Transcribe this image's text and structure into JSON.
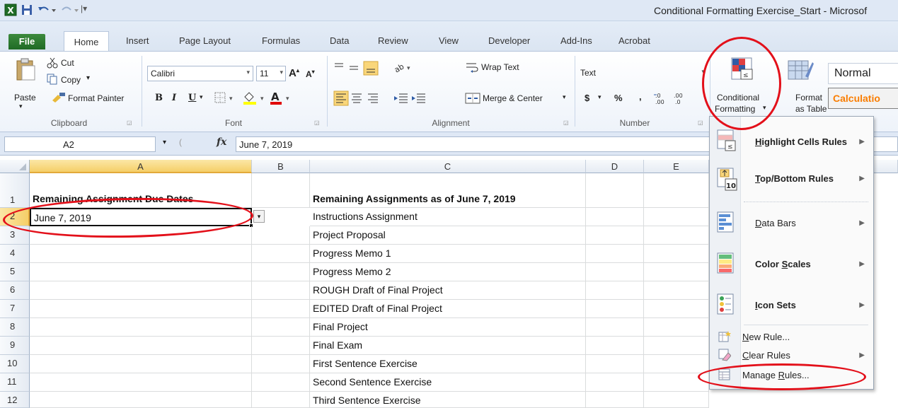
{
  "window": {
    "title": "Conditional Formatting Exercise_Start  -  Microsof"
  },
  "tabs": [
    "File",
    "Home",
    "Insert",
    "Page Layout",
    "Formulas",
    "Data",
    "Review",
    "View",
    "Developer",
    "Add-Ins",
    "Acrobat"
  ],
  "ribbon": {
    "clipboard": {
      "paste": "Paste",
      "cut": "Cut",
      "copy": "Copy",
      "copy_arrow": "▾",
      "format_painter": "Format Painter",
      "label": "Clipboard"
    },
    "font": {
      "name": "Calibri",
      "size": "11",
      "bold": "B",
      "italic": "I",
      "underline": "U",
      "label": "Font"
    },
    "alignment": {
      "wrap_text": "Wrap Text",
      "merge_center": "Merge & Center",
      "label": "Alignment"
    },
    "number": {
      "format": "Text",
      "dollar": "$",
      "percent": "%",
      "comma": ",",
      "label": "Number"
    },
    "styles": {
      "conditional_formatting_line1": "Conditional",
      "conditional_formatting_line2": "Formatting",
      "format_table_line1": "Format",
      "format_table_line2": "as Table",
      "style_normal": "Normal",
      "style_calculation": "Calculatio"
    }
  },
  "formula_bar": {
    "name_box": "A2",
    "fx": "fx",
    "value": "June 7, 2019"
  },
  "columns": [
    "A",
    "B",
    "C",
    "D",
    "E"
  ],
  "rows": [
    "1",
    "2",
    "3",
    "4",
    "5",
    "6",
    "7",
    "8",
    "9",
    "10",
    "11",
    "12"
  ],
  "cells": {
    "A1": "Remaining Assignment Due Dates",
    "C1": "Remaining Assignments as of June 7, 2019",
    "A2": "June 7, 2019",
    "C2": "Instructions Assignment",
    "C3": "Project Proposal",
    "C4": "Progress Memo 1",
    "C5": "Progress Memo 2",
    "C6": "ROUGH Draft of Final Project",
    "C7": "EDITED Draft of Final Project",
    "C8": "Final Project",
    "C9": "Final Exam",
    "C10": "First Sentence Exercise",
    "C11": "Second Sentence Exercise",
    "C12": "Third Sentence Exercise"
  },
  "cf_menu": {
    "items": [
      {
        "label": "Highlight Cells Rules",
        "accel": "H",
        "submenu": true
      },
      {
        "label": "Top/Bottom Rules",
        "accel": "T",
        "submenu": true
      },
      {
        "label": "Data Bars",
        "accel": "D",
        "submenu": true
      },
      {
        "label": "Color Scales",
        "accel": "S",
        "submenu": true
      },
      {
        "label": "Icon Sets",
        "accel": "I",
        "submenu": true
      }
    ],
    "small_items": [
      {
        "label": "New Rule...",
        "accel": "N",
        "submenu": false
      },
      {
        "label": "Clear Rules",
        "accel": "C",
        "submenu": true
      },
      {
        "label": "Manage Rules...",
        "accel": "R",
        "submenu": false
      }
    ]
  },
  "colors": {
    "annotation": "#e3101a",
    "file_tab": "#2a7a2f",
    "selection": "#f9d67a"
  }
}
